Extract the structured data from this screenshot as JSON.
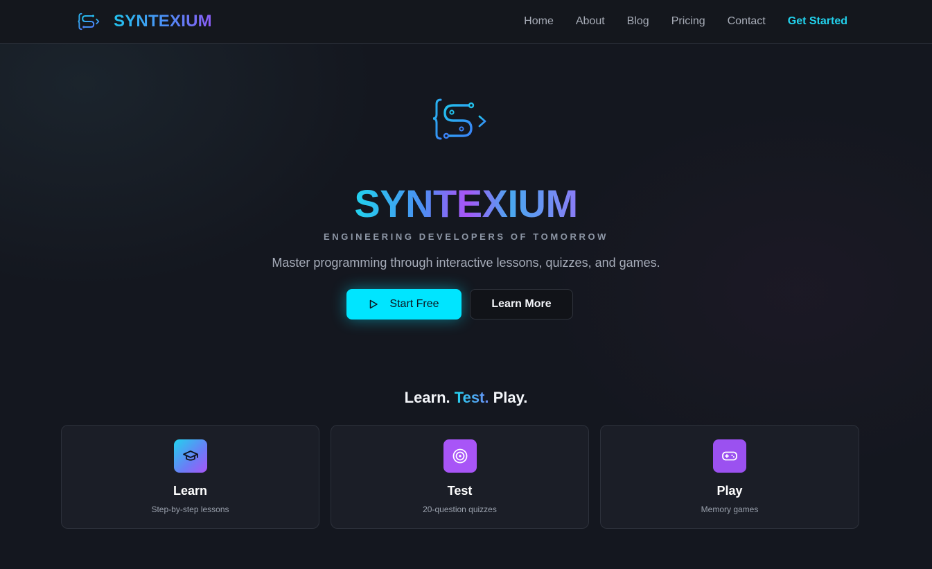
{
  "header": {
    "brand": "SYNTEXIUM",
    "logo_icon": "syntexium-s-circuit-logo",
    "nav": [
      {
        "label": "Home"
      },
      {
        "label": "About"
      },
      {
        "label": "Blog"
      },
      {
        "label": "Pricing"
      },
      {
        "label": "Contact"
      },
      {
        "label": "Get Started"
      }
    ]
  },
  "hero": {
    "title": "SYNTEXIUM",
    "tagline": "ENGINEERING DEVELOPERS OF TOMORROW",
    "subtitle": "Master programming through interactive lessons, quizzes, and games.",
    "primary_button": {
      "label": "Start Free",
      "icon": "play-icon"
    },
    "secondary_button": {
      "label": "Learn More"
    }
  },
  "features": {
    "heading_part1": "Learn.",
    "heading_part2": "Test.",
    "heading_part3": "Play.",
    "cards": [
      {
        "title": "Learn",
        "description": "Step-by-step lessons",
        "icon": "graduation-cap-icon"
      },
      {
        "title": "Test",
        "description": "20-question quizzes",
        "icon": "target-icon"
      },
      {
        "title": "Play",
        "description": "Memory games",
        "icon": "gamepad-icon"
      }
    ]
  },
  "colors": {
    "accent_cyan": "#00e5ff",
    "accent_purple": "#a855f7",
    "background": "#14171f"
  }
}
